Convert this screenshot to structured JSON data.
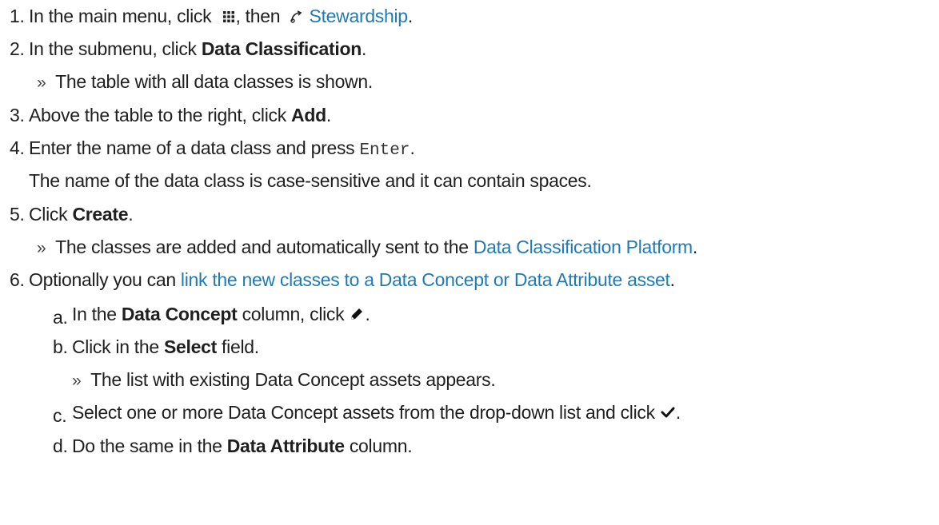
{
  "steps": [
    {
      "num": "1.",
      "t1": "In the main menu, click",
      "icon1": "apps-grid-icon",
      "t2": ", then",
      "icon2": "stewardship-icon",
      "link": "Stewardship",
      "t3": "."
    },
    {
      "num": "2.",
      "t1": "In the submenu, click",
      "b1": "Data Classification",
      "t2": ".",
      "result": "The table with all data classes is shown."
    },
    {
      "num": "3.",
      "t1": "Above the table to the right, click",
      "b1": "Add",
      "t2": "."
    },
    {
      "num": "4.",
      "t1": "Enter the name of a data class and press",
      "code": "Enter",
      "t2": ".",
      "note": "The name of the data class is case-sensitive and it can contain spaces."
    },
    {
      "num": "5.",
      "t1": "Click",
      "b1": "Create",
      "t2": ".",
      "result_t1": "The classes are added and automatically sent to the",
      "result_link": "Data Classification Platform",
      "result_t2": "."
    },
    {
      "num": "6.",
      "t1": "Optionally you can",
      "link": "link the new classes to a Data Concept or Data Attribute asset",
      "t2": ".",
      "substeps": [
        {
          "letter": "a.",
          "t1": "In the",
          "b1": "Data Concept",
          "t2": "column, click",
          "icon": "pencil-icon",
          "t3": "."
        },
        {
          "letter": "b.",
          "t1": "Click in the",
          "b1": "Select",
          "t2": "field.",
          "result": "The list with existing Data Concept assets appears."
        },
        {
          "letter": "c.",
          "t1": "Select one or more Data Concept assets from the drop-down list and click",
          "icon": "checkmark-icon",
          "t2": "."
        },
        {
          "letter": "d.",
          "t1": "Do the same in the",
          "b1": "Data Attribute",
          "t2": "column."
        }
      ]
    }
  ],
  "result_marker": "»"
}
